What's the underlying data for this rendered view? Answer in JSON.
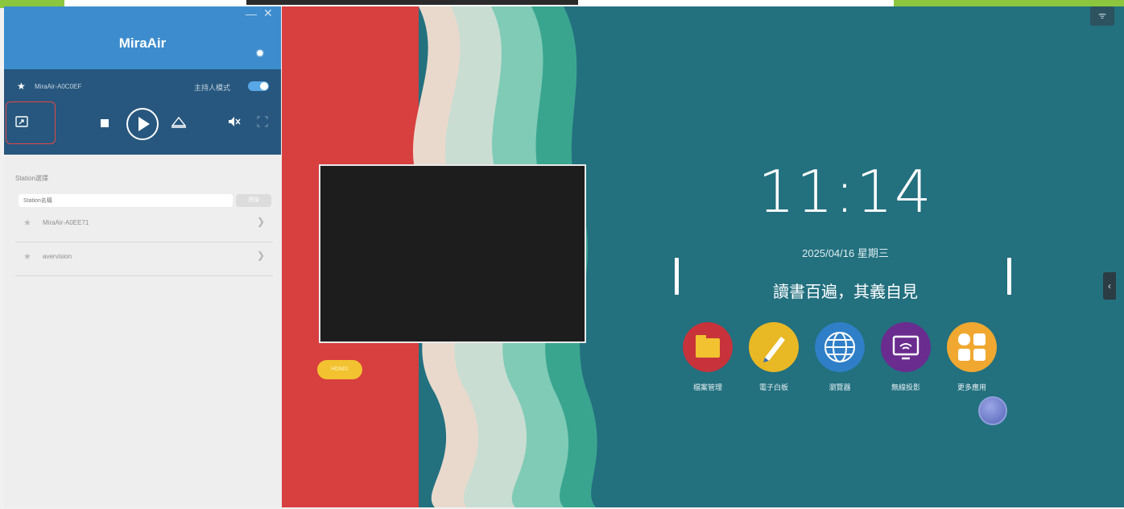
{
  "panel": {
    "title": "MiraAir",
    "minimize": "—",
    "close": "✕",
    "device_name": "MiraAir-A0C0EF",
    "host_mode_label": "主持人模式",
    "station_label": "Station選擇",
    "station_placeholder": "Station名稱",
    "station_button": "連線",
    "stations": [
      {
        "name": "MiraAir-A0EE71"
      },
      {
        "name": "avervision"
      }
    ]
  },
  "desktop": {
    "hdmi_label": "HDMI1",
    "clock": "11:14",
    "date": "2025/04/16  星期三",
    "motto": "讀書百遍，其義自見",
    "apps": [
      {
        "label": "檔案管理",
        "icon": "folder-icon",
        "color": "#c8323a"
      },
      {
        "label": "電子白板",
        "icon": "whiteboard-pen-icon",
        "color": "#e8b825"
      },
      {
        "label": "瀏覽器",
        "icon": "globe-icon",
        "color": "#2f7fc8"
      },
      {
        "label": "無線投影",
        "icon": "wireless-projection-icon",
        "color": "#6a2c8f"
      },
      {
        "label": "更多應用",
        "icon": "more-apps-icon",
        "color": "#f0a830"
      }
    ],
    "wifi_icon": "wifi-icon",
    "side_tab": "‹"
  },
  "colors": {
    "panel_header": "#3d8ccd",
    "device_bar": "#27577e",
    "desktop_bg": "#23707f",
    "highlight": "#e64646"
  }
}
